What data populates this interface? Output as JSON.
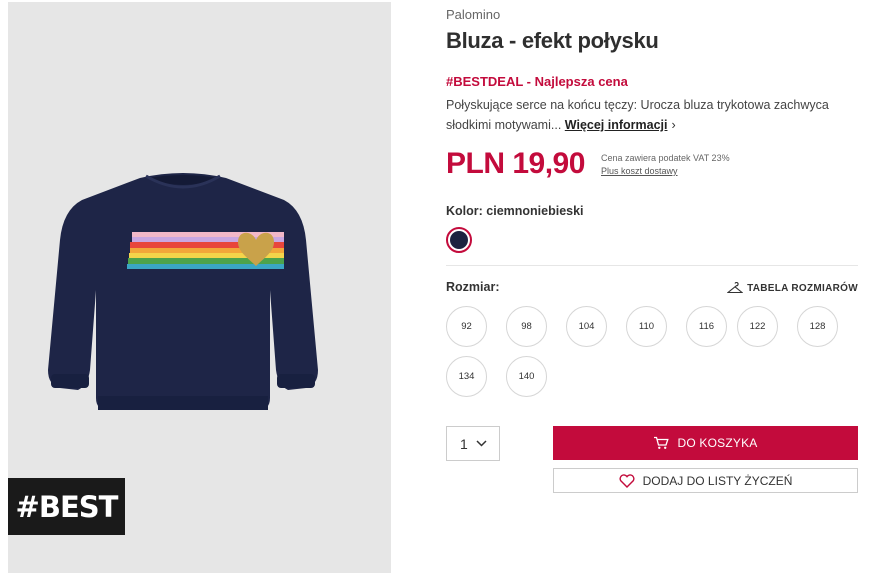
{
  "product": {
    "brand": "Palomino",
    "title": "Bluza - efekt połysku",
    "deal": "#BESTDEAL - Najlepsza cena",
    "description": "Połyskujące serce na końcu tęczy: Urocza bluza trykotowa zachwyca słodkimi motywami...",
    "more_link": "Więcej informacji",
    "price": "PLN 19,90",
    "tax_note": "Cena zawiera podatek VAT 23%",
    "shipping_link": "Plus koszt dostawy",
    "color_label": "Kolor: ciemnoniebieski",
    "color_hex": "#1c2340"
  },
  "badge": {
    "text": "#BEST"
  },
  "sizes": {
    "label": "Rozmiar:",
    "table_link": "TABELA ROZMIARÓW",
    "options": [
      "92",
      "98",
      "104",
      "110",
      "116",
      "122",
      "128",
      "134",
      "140"
    ]
  },
  "purchase": {
    "quantity": "1",
    "add_to_cart": "DO KOSZYKA",
    "wishlist": "DODAJ DO LISTY ŻYCZEŃ"
  },
  "colors": {
    "accent": "#c30b3c",
    "badge_bg": "#1a1a1a",
    "image_bg": "#e6e6e6"
  }
}
